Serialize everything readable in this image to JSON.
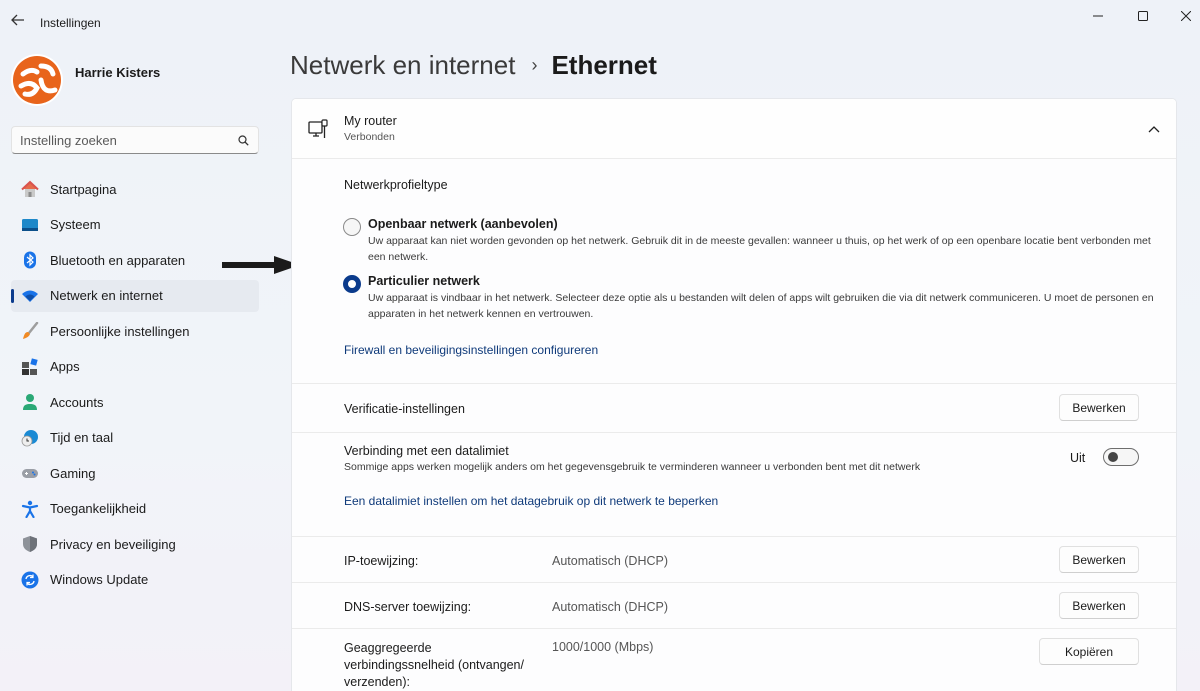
{
  "window": {
    "title": "Instellingen",
    "controls": {
      "minimize": "minimize",
      "maximize": "maximize",
      "close": "close"
    }
  },
  "sidebar": {
    "user_name": "Harrie Kisters",
    "search": {
      "placeholder": "Instelling zoeken",
      "value": ""
    },
    "items": [
      {
        "label": "Startpagina",
        "icon": "home-icon",
        "active": false
      },
      {
        "label": "Systeem",
        "icon": "system-icon",
        "active": false
      },
      {
        "label": "Bluetooth en apparaten",
        "icon": "bluetooth-icon",
        "active": false
      },
      {
        "label": "Netwerk en internet",
        "icon": "wifi-icon",
        "active": true
      },
      {
        "label": "Persoonlijke instellingen",
        "icon": "brush-icon",
        "active": false
      },
      {
        "label": "Apps",
        "icon": "apps-icon",
        "active": false
      },
      {
        "label": "Accounts",
        "icon": "person-icon",
        "active": false
      },
      {
        "label": "Tijd en taal",
        "icon": "clock-globe-icon",
        "active": false
      },
      {
        "label": "Gaming",
        "icon": "gamepad-icon",
        "active": false
      },
      {
        "label": "Toegankelijkheid",
        "icon": "accessibility-icon",
        "active": false
      },
      {
        "label": "Privacy en beveiliging",
        "icon": "shield-icon",
        "active": false
      },
      {
        "label": "Windows Update",
        "icon": "update-icon",
        "active": false
      }
    ]
  },
  "breadcrumb": {
    "parent": "Netwerk en internet",
    "separator": "›",
    "current": "Ethernet"
  },
  "connection": {
    "name": "My router",
    "status": "Verbonden"
  },
  "profile_type": {
    "label": "Netwerkprofieltype",
    "options": [
      {
        "title": "Openbaar netwerk (aanbevolen)",
        "description": "Uw apparaat kan niet worden gevonden op het netwerk. Gebruik dit in de meeste gevallen: wanneer u thuis, op het werk of op een openbare locatie bent verbonden met een netwerk.",
        "selected": false
      },
      {
        "title": "Particulier netwerk",
        "description": "Uw apparaat is vindbaar in het netwerk. Selecteer deze optie als u bestanden wilt delen of apps wilt gebruiken die via dit netwerk communiceren. U moet de personen en apparaten in het netwerk kennen en vertrouwen.",
        "selected": true
      }
    ],
    "firewall_link": "Firewall en beveiligingsinstellingen configureren"
  },
  "verification": {
    "label": "Verificatie-instellingen",
    "button": "Bewerken"
  },
  "metered": {
    "label": "Verbinding met een datalimiet",
    "description": "Sommige apps werken mogelijk anders om het gegevensgebruik te verminderen wanneer u verbonden bent met dit netwerk",
    "toggle_state": "Uit",
    "toggle_on": false,
    "link": "Een datalimiet instellen om het datagebruik op dit netwerk te beperken"
  },
  "ip_assignment": {
    "label": "IP-toewijzing:",
    "value": "Automatisch (DHCP)",
    "button": "Bewerken"
  },
  "dns_assignment": {
    "label": "DNS-server toewijzing:",
    "value": "Automatisch (DHCP)",
    "button": "Bewerken"
  },
  "link_speed": {
    "label": "Geaggregeerde verbindingssnelheid (ontvangen/ verzenden):",
    "value": "1000/1000 (Mbps)",
    "button": "Kopiëren"
  },
  "colors": {
    "accent": "#0b3b8c",
    "link": "#0f3a7a",
    "avatar_orange": "#e8641b"
  }
}
